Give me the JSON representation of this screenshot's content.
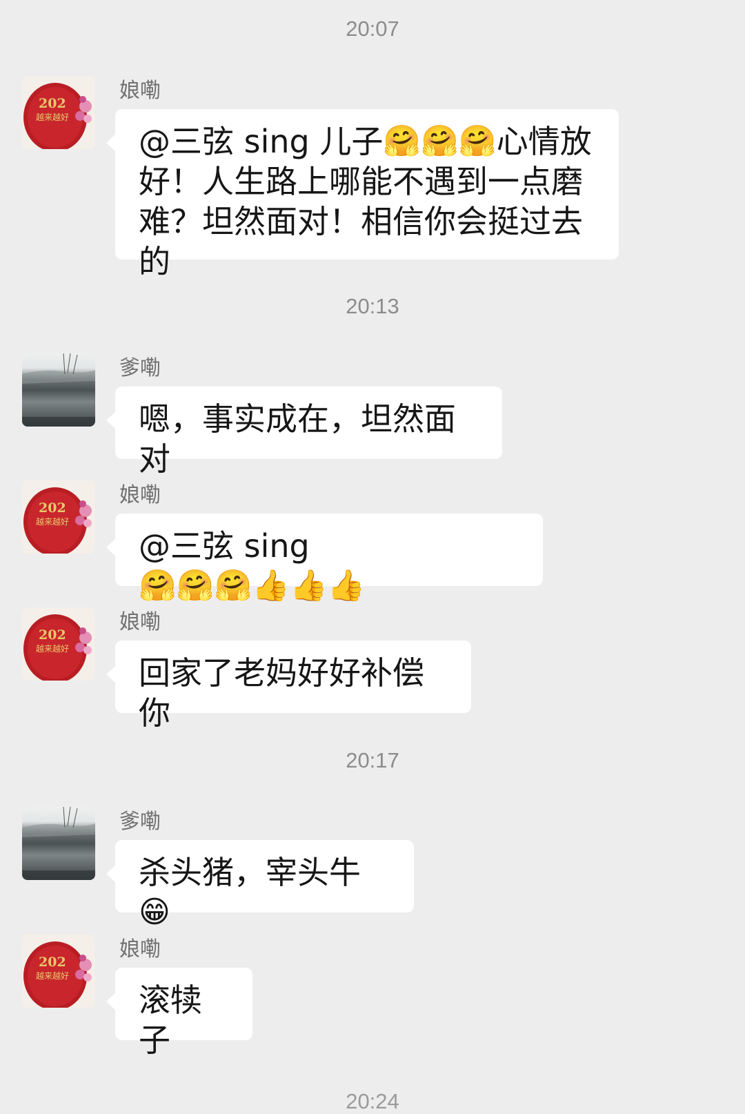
{
  "timestamps": [
    "20:07",
    "20:13",
    "20:17",
    "20:24"
  ],
  "senders": {
    "mom": "娘嘞",
    "dad": "爹嘞"
  },
  "avatar_text": {
    "mom_year": "202",
    "mom_caption": "越来越好"
  },
  "messages": [
    {
      "line1": "@三弦 sing  儿子",
      "emoji1": "🤗🤗🤗",
      "line1b": "心情放",
      "line2": "好！人生路上哪能不遇到一点磨",
      "line3": "难？坦然面对！相信你会挺过去的"
    },
    {
      "text": "嗯，事实成在，坦然面对"
    },
    {
      "text": "@三弦 sing ",
      "emoji": "🤗🤗🤗👍👍👍"
    },
    {
      "text": "回家了老妈好好补偿你"
    },
    {
      "text": "杀头猪，宰头牛",
      "emoji": "😁"
    },
    {
      "text": "滚犊子"
    }
  ],
  "colors": {
    "background": "#ededed",
    "bubble": "#ffffff",
    "timestamp": "#8c8c8c",
    "avatar_red": "#c0242a"
  }
}
